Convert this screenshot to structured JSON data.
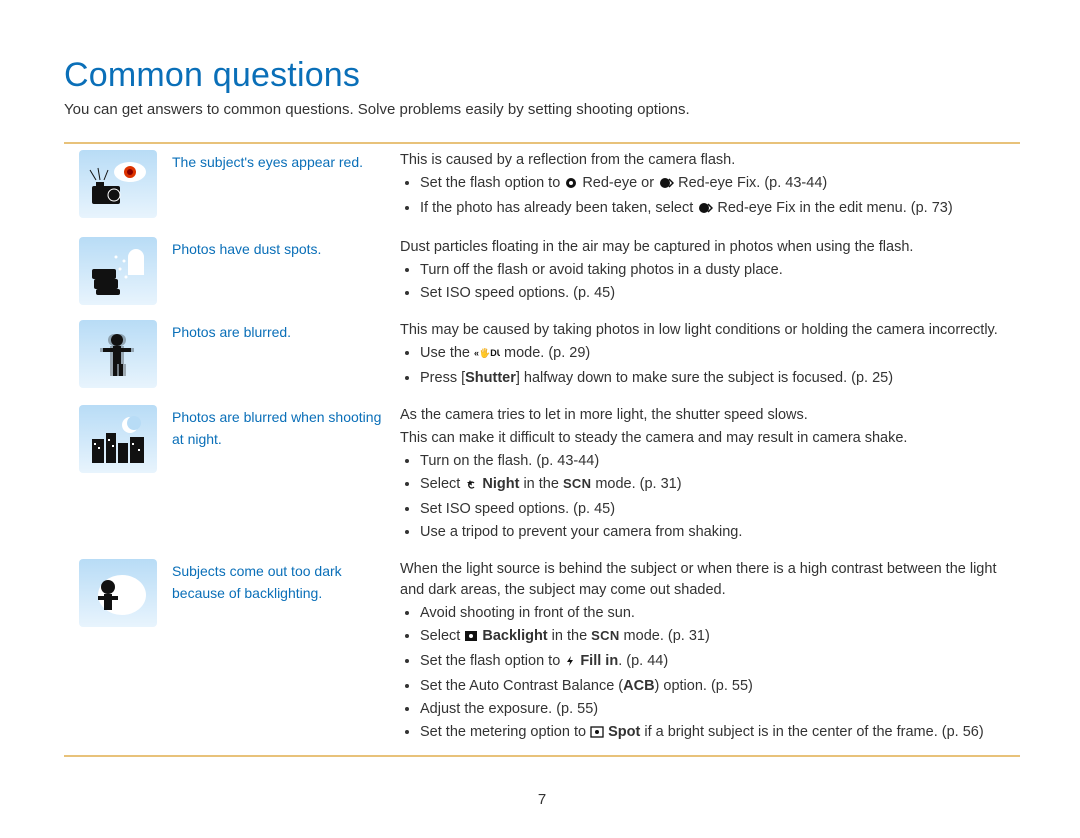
{
  "title": "Common questions",
  "intro": "You can get answers to common questions. Solve problems easily by setting shooting options.",
  "rows": [
    {
      "label": "The subject's eyes appear red.",
      "lead": "This is caused by a reflection from the camera flash.",
      "bullets": [
        {
          "pre": "Set the flash option to ",
          "icon": "redeye",
          "mid": " Red-eye or ",
          "icon2": "redeye-fix",
          "post": " Red-eye Fix. (p. 43-44)"
        },
        {
          "pre": "If the photo has already been taken, select ",
          "icon": "redeye-fix",
          "post": " Red-eye Fix in the edit menu. (p. 73)"
        }
      ]
    },
    {
      "label": "Photos have dust spots.",
      "lead": "Dust particles floating in the air may be captured in photos when using the flash.",
      "bullets": [
        {
          "text": "Turn off the flash or avoid taking photos in a dusty place."
        },
        {
          "text": "Set ISO speed options. (p. 45)"
        }
      ]
    },
    {
      "label": "Photos are blurred.",
      "lead": "This may be caused by taking photos in low light conditions or holding the camera incorrectly.",
      "bullets": [
        {
          "pre": "Use the ",
          "icon": "dual",
          "post": " mode. (p. 29)"
        },
        {
          "pre": "Press [",
          "bold": "Shutter",
          "post": "] halfway down to make sure the subject is focused. (p. 25)"
        }
      ]
    },
    {
      "label": "Photos are blurred when shooting at night.",
      "lead": "As the camera tries to let in more light, the shutter speed slows.",
      "lead2": "This can make it difficult to steady the camera and may result in camera shake.",
      "bullets": [
        {
          "text": "Turn on the flash. (p. 43-44)"
        },
        {
          "pre": "Select ",
          "icon": "night",
          "post_pre": " ",
          "bold": "Night",
          "post": " in the ",
          "scn": "SCN",
          "tail": " mode. (p. 31)"
        },
        {
          "text": "Set ISO speed options. (p. 45)"
        },
        {
          "text": "Use a tripod to prevent your camera from shaking."
        }
      ]
    },
    {
      "label": "Subjects come out too dark because of backlighting.",
      "lead": "When the light source is behind the subject or when there is a high contrast between the light and dark areas, the subject may come out shaded.",
      "bullets": [
        {
          "text": "Avoid shooting in front of the sun."
        },
        {
          "pre": "Select ",
          "icon": "backlight",
          "post_pre": " ",
          "bold": "Backlight",
          "post": " in the ",
          "scn": "SCN",
          "tail": " mode. (p. 31)"
        },
        {
          "pre": "Set the flash option to ",
          "icon": "fillin",
          "post_pre": " ",
          "bold": "Fill in",
          "post": ". (p. 44)"
        },
        {
          "pre": "Set the Auto Contrast Balance (",
          "bold": "ACB",
          "post": ") option. (p. 55)"
        },
        {
          "text": "Adjust the exposure. (p. 55)"
        },
        {
          "pre": "Set the metering option to ",
          "icon": "spot",
          "post_pre": " ",
          "bold": "Spot",
          "post": " if a bright subject is in the center of the frame. (p. 56)"
        }
      ]
    }
  ],
  "page_number": "7",
  "icon_svgs": {
    "eye-red": "eye-red",
    "dust": "dust",
    "blur": "blur",
    "night-city": "night-city",
    "backlit": "backlit"
  }
}
